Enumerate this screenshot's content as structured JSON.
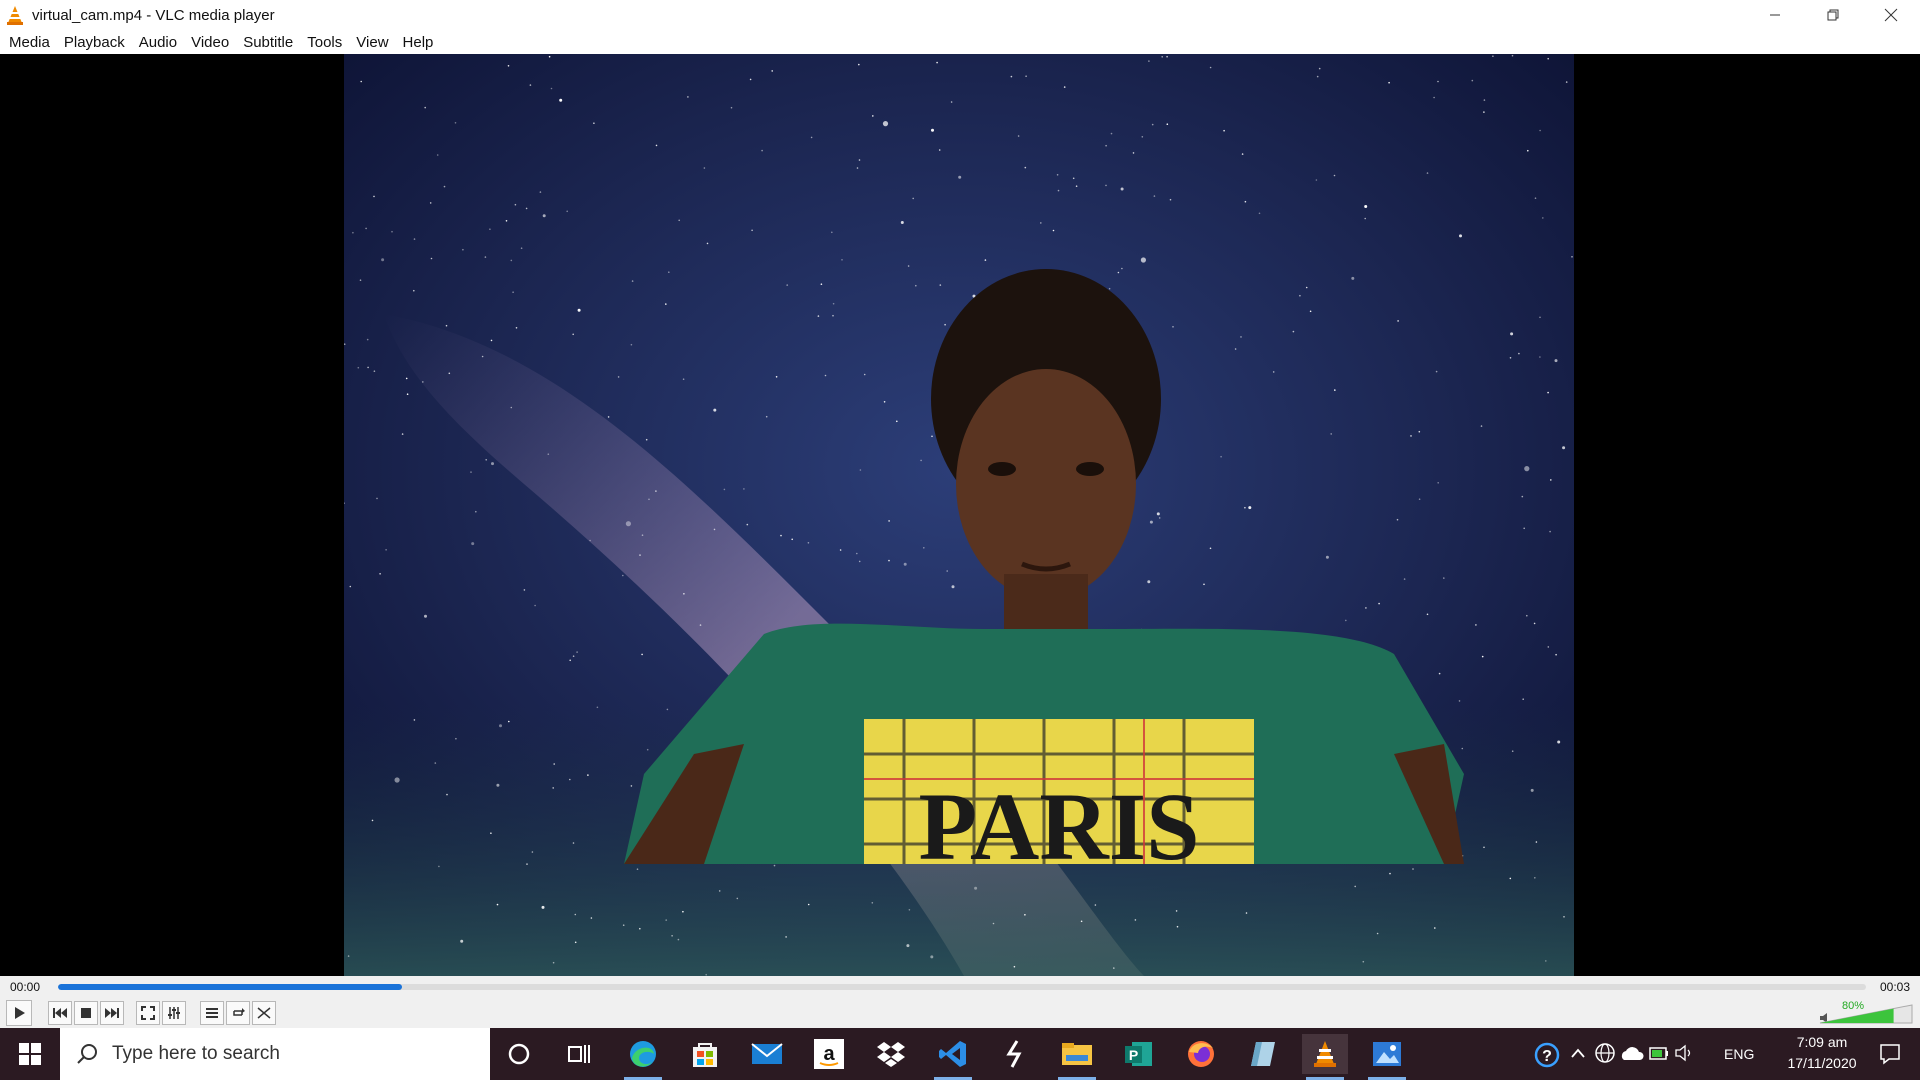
{
  "window": {
    "title": "virtual_cam.mp4 - VLC media player"
  },
  "menu": {
    "items": [
      "Media",
      "Playback",
      "Audio",
      "Video",
      "Subtitle",
      "Tools",
      "View",
      "Help"
    ]
  },
  "player": {
    "elapsed": "00:00",
    "total": "00:03",
    "progress": 0.19,
    "volume_label": "80%",
    "volume": 0.8,
    "accent_color": "#1a73d9"
  },
  "video": {
    "shirt_text": "PARIS"
  },
  "taskbar": {
    "search_placeholder": "Type here to search",
    "apps": [
      "cortana-icon",
      "task-view-icon",
      "edge-icon",
      "store-icon",
      "mail-icon",
      "amazon-icon",
      "dropbox-icon",
      "vscode-icon",
      "unity-icon",
      "file-explorer-icon",
      "publisher-icon",
      "firefox-icon",
      "notes-icon",
      "vlc-icon",
      "photos-icon"
    ],
    "language": "ENG",
    "time": "7:09 am",
    "date": "17/11/2020"
  }
}
